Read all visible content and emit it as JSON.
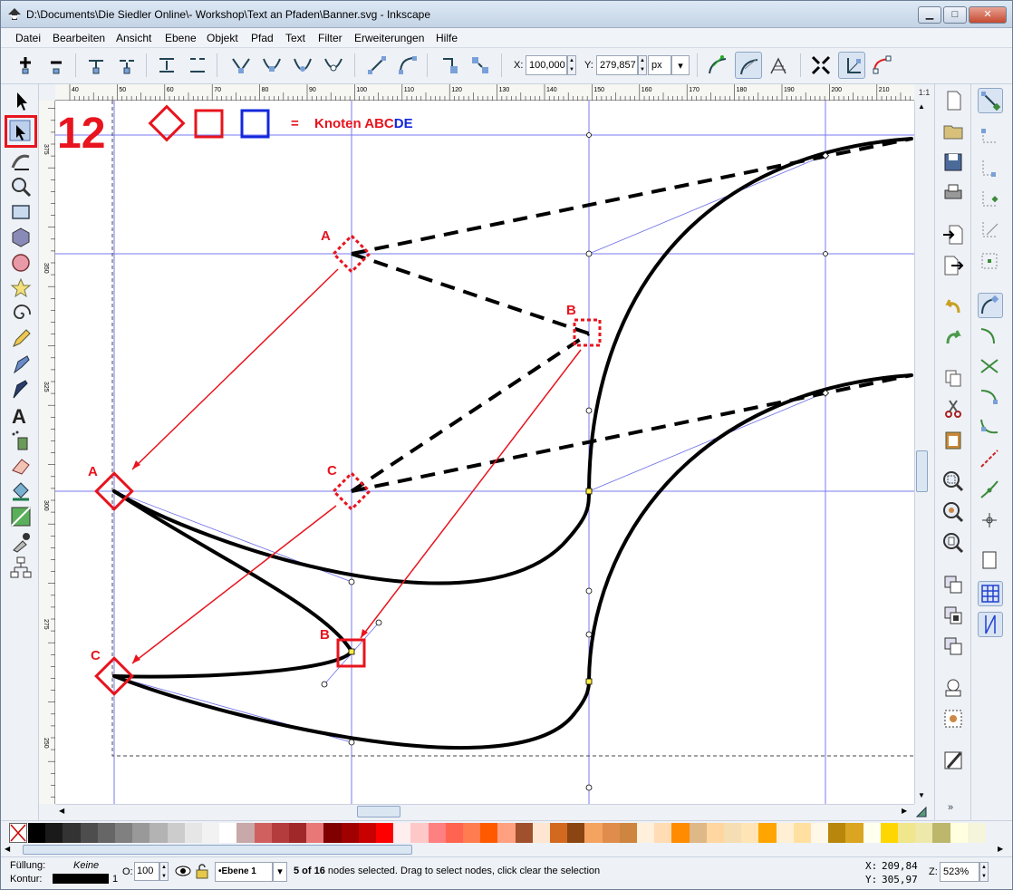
{
  "window": {
    "title": "D:\\Documents\\Die Siedler Online\\- Workshop\\Text an Pfaden\\Banner.svg - Inkscape",
    "minimize": "▁",
    "maximize": "□",
    "close": "✕"
  },
  "menu": [
    "Datei",
    "Bearbeiten",
    "Ansicht",
    "Ebene",
    "Objekt",
    "Pfad",
    "Text",
    "Filter",
    "Erweiterungen",
    "Hilfe"
  ],
  "toolbar": {
    "x_label": "X:",
    "x_value": "100,000",
    "y_label": "Y:",
    "y_value": "279,857",
    "unit": "px"
  },
  "ruler": {
    "h_ticks": [
      "40",
      "50",
      "60",
      "70",
      "80",
      "90",
      "100",
      "110",
      "120",
      "130",
      "140",
      "150",
      "160",
      "170",
      "180",
      "190",
      "200",
      "210"
    ],
    "v_ticks": [
      "375",
      "350",
      "325",
      "300",
      "275",
      "250"
    ]
  },
  "annotation": {
    "step_number": "12",
    "equals": "=",
    "legend_text": "Knoten ABC",
    "legend_text_blue": "DE",
    "labels": [
      "A",
      "B",
      "C",
      "A",
      "B",
      "C"
    ]
  },
  "palette": {
    "colors": [
      "#000000",
      "#1a1a1a",
      "#333333",
      "#4d4d4d",
      "#666666",
      "#808080",
      "#999999",
      "#b3b3b3",
      "#cccccc",
      "#e6e6e6",
      "#f2f2f2",
      "#ffffff",
      "#c8a8a8",
      "#d06060",
      "#b43c3c",
      "#a02828",
      "#e87878",
      "#800000",
      "#a00000",
      "#c80000",
      "#ff0000",
      "#ffeeee",
      "#ffc8c8",
      "#ff8080",
      "#ff6450",
      "#ff7c50",
      "#ff5a00",
      "#ffa080",
      "#a0502d",
      "#ffe6d2",
      "#d2691e",
      "#8b4513",
      "#f4a460",
      "#e08c4c",
      "#cd853f",
      "#fff0dc",
      "#ffdcb4",
      "#ff8c00",
      "#deb887",
      "#ffd6a0",
      "#f5deb3",
      "#ffe4b5",
      "#ffa500",
      "#ffefd5",
      "#ffe0a0",
      "#fff8e8",
      "#b8860b",
      "#daa520",
      "#fffff0",
      "#ffd700",
      "#f0e68c",
      "#eee8aa",
      "#bdb76b",
      "#ffffe0",
      "#f5f5dc"
    ]
  },
  "status": {
    "fill_label": "Füllung:",
    "fill_value": "Keine",
    "stroke_label": "Kontur:",
    "stroke_width": "1",
    "opacity_label": "O:",
    "opacity_value": "100",
    "layer": "•Ebene 1",
    "message_bold": "5 of 16",
    "message": " nodes selected. Drag to select nodes, click clear the selection",
    "cursor_x_label": "X:",
    "cursor_x": "209,84",
    "cursor_y_label": "Y:",
    "cursor_y": "305,97",
    "zoom_label": "Z:",
    "zoom": "523%"
  },
  "colors": {
    "accent_red": "#e8141e",
    "guide_blue": "#5a5af0",
    "legend_blue": "#1428dc"
  }
}
